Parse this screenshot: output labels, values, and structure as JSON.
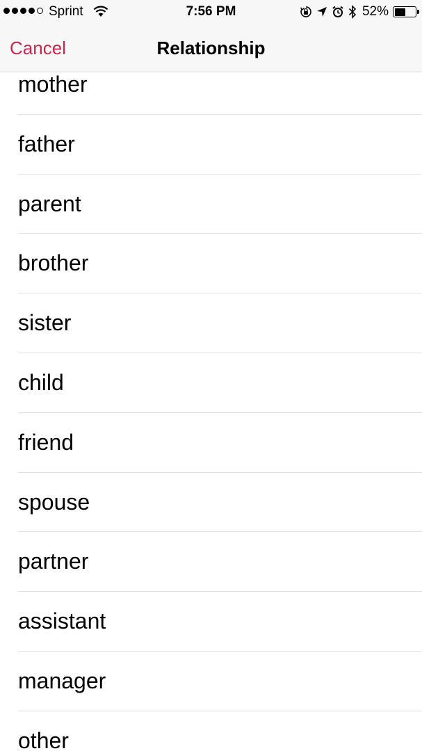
{
  "status_bar": {
    "carrier": "Sprint",
    "time": "7:56 PM",
    "battery_percent": "52%",
    "battery_level": 0.52,
    "signal_bars_filled": 4,
    "signal_bars_total": 5,
    "icons": [
      "wifi-icon",
      "orientation-lock-icon",
      "location-icon",
      "alarm-icon",
      "bluetooth-icon",
      "battery-icon"
    ]
  },
  "nav": {
    "cancel_label": "Cancel",
    "title": "Relationship",
    "accent_color": "#c8284d"
  },
  "relationships": [
    "mother",
    "father",
    "parent",
    "brother",
    "sister",
    "child",
    "friend",
    "spouse",
    "partner",
    "assistant",
    "manager",
    "other"
  ]
}
